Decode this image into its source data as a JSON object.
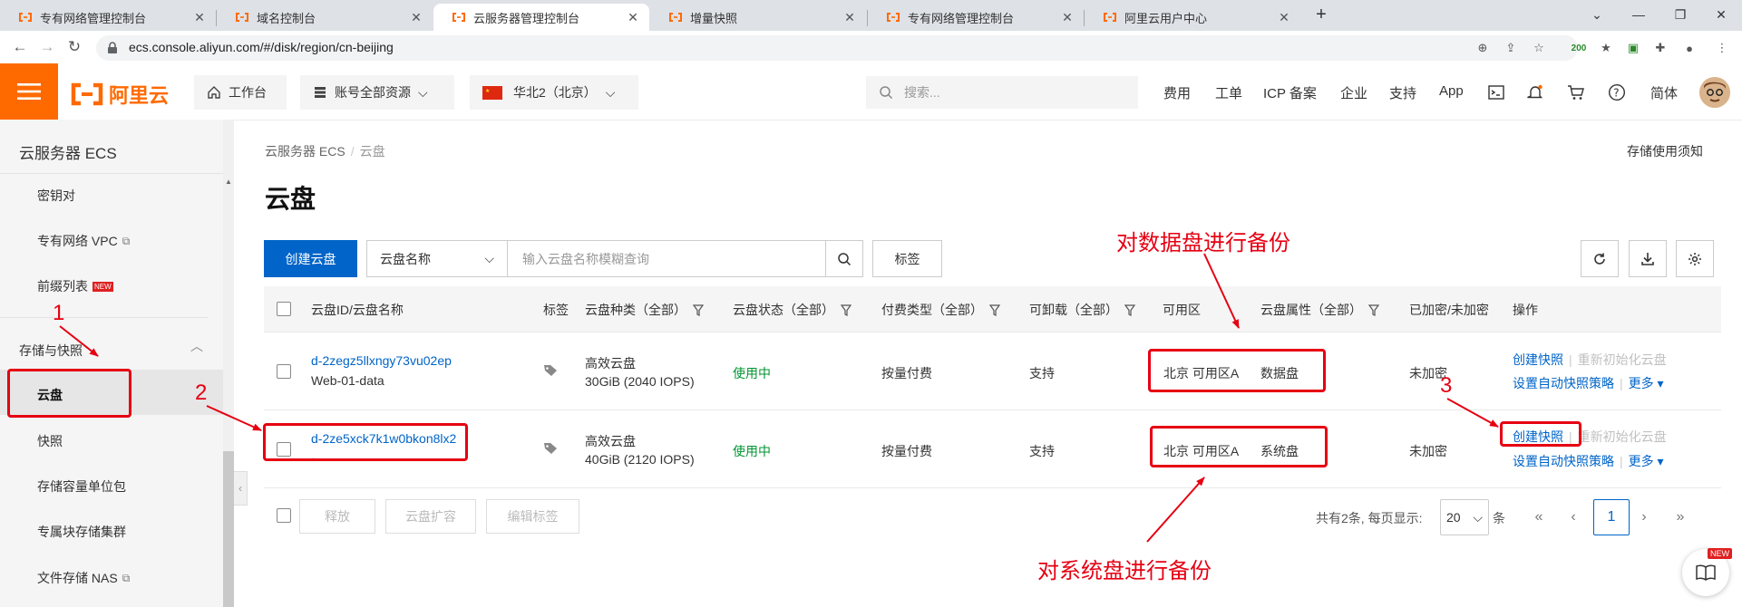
{
  "browser": {
    "tabs": [
      {
        "title": "专有网络管理控制台",
        "active": false
      },
      {
        "title": "域名控制台",
        "active": false
      },
      {
        "title": "云服务器管理控制台",
        "active": true
      },
      {
        "title": "增量快照",
        "active": false
      },
      {
        "title": "专有网络管理控制台",
        "active": false
      },
      {
        "title": "阿里云用户中心",
        "active": false
      }
    ],
    "url": "ecs.console.aliyun.com/#/disk/region/cn-beijing",
    "ext_badge": "200"
  },
  "header": {
    "logo_text": "阿里云",
    "workbench": "工作台",
    "resource_scope": "账号全部资源",
    "region": "华北2（北京）",
    "search_placeholder": "搜索...",
    "links": [
      "费用",
      "工单",
      "ICP 备案",
      "企业",
      "支持",
      "App"
    ],
    "language": "简体"
  },
  "sidebar": {
    "title": "云服务器 ECS",
    "items": [
      {
        "label": "密钥对",
        "external": false,
        "badge": ""
      },
      {
        "label": "专有网络 VPC",
        "external": true,
        "badge": ""
      },
      {
        "label": "前缀列表",
        "external": false,
        "badge": "NEW"
      }
    ],
    "group": "存储与快照",
    "group_items": [
      {
        "label": "云盘",
        "active": true,
        "external": false
      },
      {
        "label": "快照",
        "active": false,
        "external": false
      },
      {
        "label": "存储容量单位包",
        "active": false,
        "external": false
      },
      {
        "label": "专属块存储集群",
        "active": false,
        "external": false
      },
      {
        "label": "文件存储 NAS",
        "active": false,
        "external": true
      }
    ]
  },
  "main": {
    "breadcrumb": [
      "云服务器 ECS",
      "云盘"
    ],
    "notice_link": "存储使用须知",
    "title": "云盘",
    "create_button": "创建云盘",
    "filter_select": "云盘名称",
    "search_placeholder": "输入云盘名称模糊查询",
    "tag_button": "标签"
  },
  "table": {
    "columns": [
      "云盘ID/云盘名称",
      "标签",
      "云盘种类（全部）",
      "云盘状态（全部）",
      "付费类型（全部）",
      "可卸载（全部）",
      "可用区",
      "云盘属性（全部）",
      "已加密/未加密",
      "操作"
    ],
    "rows": [
      {
        "id": "d-2zegz5llxngy73vu02ep",
        "name": "Web-01-data",
        "type": "高效云盘",
        "spec": "30GiB (2040 IOPS)",
        "status": "使用中",
        "billing": "按量付费",
        "detachable": "支持",
        "zone": "北京 可用区A",
        "attribute": "数据盘",
        "encryption": "未加密",
        "actions": [
          "创建快照",
          "重新初始化云盘",
          "设置自动快照策略",
          "更多"
        ]
      },
      {
        "id": "d-2ze5xck7k1w0bkon8lx2",
        "name": "-",
        "type": "高效云盘",
        "spec": "40GiB (2120 IOPS)",
        "status": "使用中",
        "billing": "按量付费",
        "detachable": "支持",
        "zone": "北京 可用区A",
        "attribute": "系统盘",
        "encryption": "未加密",
        "actions": [
          "创建快照",
          "重新初始化云盘",
          "设置自动快照策略",
          "更多"
        ]
      }
    ]
  },
  "bulk_actions": [
    "释放",
    "云盘扩容",
    "编辑标签"
  ],
  "pagination": {
    "summary": "共有2条, 每页显示:",
    "page_size": "20",
    "unit": "条",
    "current_page": "1"
  },
  "help_badge": "NEW",
  "annotations": {
    "data_disk_note": "对数据盘进行备份",
    "system_disk_note": "对系统盘进行备份",
    "step1": "1",
    "step2": "2",
    "step3": "3"
  },
  "colors": {
    "brand": "#ff6a00",
    "primary": "#0064c8",
    "success": "#009431",
    "annotation": "#e60012"
  }
}
